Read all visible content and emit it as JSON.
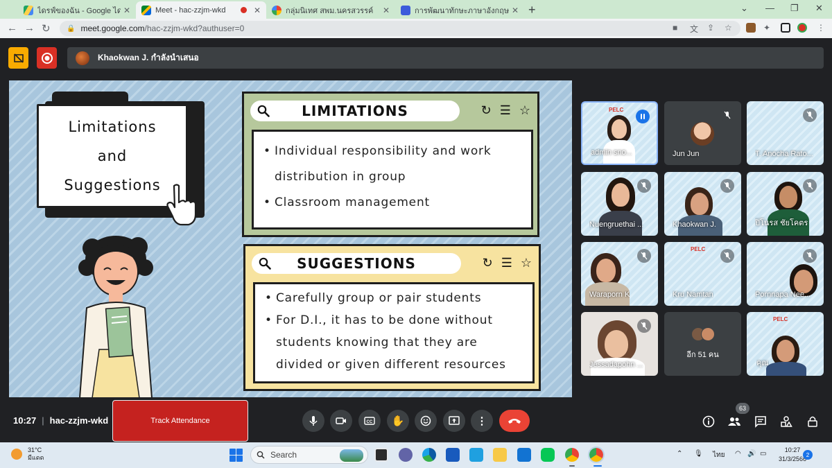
{
  "browser": {
    "tabs": [
      {
        "title": "ไดรฟ์ของฉัน - Google ไดรฟ์",
        "icon": "google-drive-icon"
      },
      {
        "title": "Meet - hac-zzjm-wkd",
        "icon": "google-meet-icon"
      },
      {
        "title": "กลุ่มนิเทศ สพม.นครสวรรค์",
        "icon": "community-icon"
      },
      {
        "title": "การพัฒนาทักษะภาษาอังกฤษ English",
        "icon": "forms-icon"
      }
    ],
    "url_host": "meet.google.com",
    "url_path": "/hac-zzjm-wkd?authuser=0"
  },
  "meet": {
    "presenting_text": "Khaokwan J. กำลังนำเสนอ",
    "time": "10:27",
    "meeting_code": "hac-zzjm-wkd",
    "track_attendance_label": "Track Attendance",
    "people_count": "63"
  },
  "slide": {
    "folder_lines": [
      "Limitations",
      "and",
      "Suggestions"
    ],
    "limitations": {
      "heading": "LIMITATIONS",
      "items": [
        "Individual responsibility and work distribution in group",
        "Classroom management"
      ]
    },
    "suggestions": {
      "heading": "SUGGESTIONS",
      "items": [
        "Carefully group or pair students",
        "For D.I., it has to be done without students knowing that they are divided or given different resources"
      ]
    }
  },
  "participants": [
    {
      "name": "admin sno...",
      "kind": "slide",
      "speaking": true
    },
    {
      "name": "Jun Jun",
      "kind": "avatar"
    },
    {
      "name": "T. Anocha Rato...",
      "kind": "slide"
    },
    {
      "name": "Nuengruethai ...",
      "kind": "camera"
    },
    {
      "name": "Khaokwan J.",
      "kind": "camera"
    },
    {
      "name": "ปิโนรส ชัยโคตร",
      "kind": "camera"
    },
    {
      "name": "Waraporn K",
      "kind": "camera"
    },
    {
      "name": "Kru Namtan",
      "kind": "slide"
    },
    {
      "name": "Pornnapa Nee...",
      "kind": "camera"
    },
    {
      "name": "Jessadapohn ...",
      "kind": "camera"
    },
    {
      "name": "อีก 51 คน",
      "kind": "more"
    },
    {
      "name": "คุณ",
      "kind": "self"
    }
  ],
  "taskbar": {
    "temperature": "31°C",
    "weather_desc": "มีแดด",
    "search_label": "Search",
    "language": "ไทย",
    "clock_time": "10:27",
    "clock_date": "31/3/2566",
    "notification_count": "2"
  },
  "colors": {
    "meet_background": "#202124",
    "end_call": "#ea4335",
    "track_attendance": "#c5221f",
    "slide_green_panel": "#b6c89c",
    "slide_yellow_panel": "#f7e3a0",
    "slide_background": "#a8c6dd"
  }
}
